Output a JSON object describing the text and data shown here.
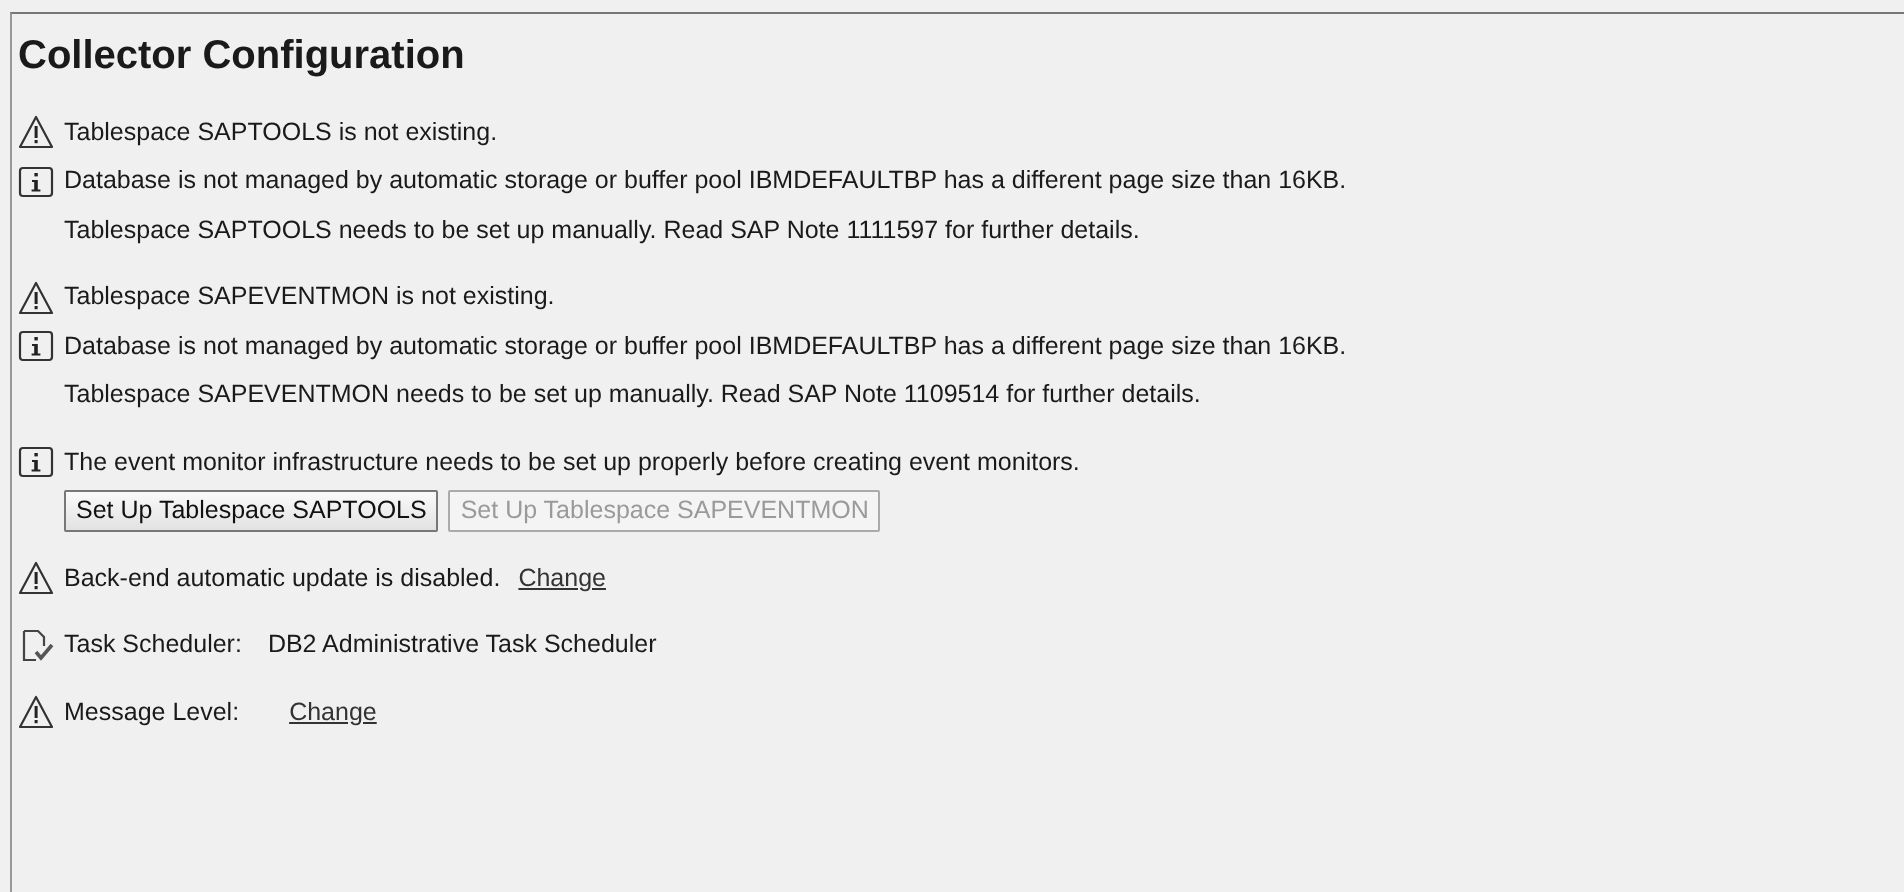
{
  "title": "Collector Configuration",
  "groups": [
    {
      "rows": [
        {
          "kind": "warning",
          "text": "Tablespace SAPTOOLS is not existing."
        },
        {
          "kind": "info",
          "text": "Database is not managed by automatic storage or buffer pool IBMDEFAULTBP has a different page size than 16KB."
        },
        {
          "kind": "plain",
          "text": "Tablespace SAPTOOLS needs to be set up manually. Read SAP Note 1111597 for further details."
        }
      ]
    },
    {
      "rows": [
        {
          "kind": "warning",
          "text": "Tablespace SAPEVENTMON is not existing."
        },
        {
          "kind": "info",
          "text": "Database is not managed by automatic storage or buffer pool IBMDEFAULTBP has a different page size than 16KB."
        },
        {
          "kind": "plain",
          "text": "Tablespace SAPEVENTMON needs to be set up manually. Read SAP Note 1109514 for further details."
        }
      ]
    },
    {
      "rows": [
        {
          "kind": "info",
          "text": "The event monitor infrastructure needs to be set up properly before creating event monitors."
        },
        {
          "kind": "buttons",
          "buttons": [
            {
              "label": "Set Up Tablespace SAPTOOLS",
              "disabled": false
            },
            {
              "label": "Set Up Tablespace SAPEVENTMON",
              "disabled": true
            }
          ]
        }
      ]
    },
    {
      "rows": [
        {
          "kind": "warning",
          "text": "Back-end automatic update is disabled.",
          "link": "Change"
        }
      ]
    },
    {
      "rows": [
        {
          "kind": "task",
          "text": "Task Scheduler:",
          "value": "DB2 Administrative Task Scheduler"
        }
      ]
    },
    {
      "rows": [
        {
          "kind": "warning",
          "text": "Message Level:",
          "link": "Change"
        }
      ]
    }
  ]
}
